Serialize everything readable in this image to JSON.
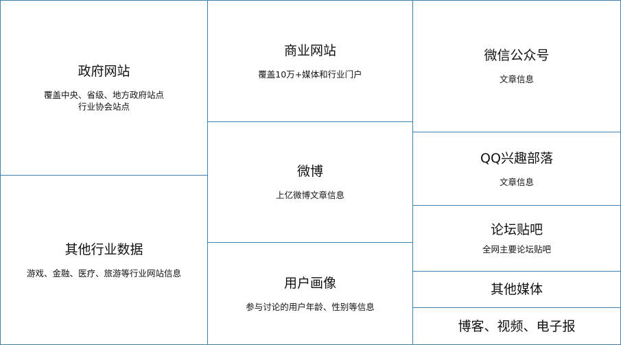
{
  "tiles": {
    "gov": {
      "title": "政府网站",
      "lines": [
        "覆盖中央、省级、地方政府站点",
        "行业协会站点"
      ]
    },
    "other_industry": {
      "title": "其他行业数据",
      "lines": [
        "游戏、金融、医疗、旅游等行业网站信息"
      ]
    },
    "business": {
      "title": "商业网站",
      "lines": [
        "覆盖10万+媒体和行业门户"
      ]
    },
    "weibo": {
      "title": "微博",
      "lines": [
        "上亿微博文章信息"
      ]
    },
    "user_profile": {
      "title": "用户画像",
      "lines": [
        "参与讨论的用户年龄、性别等信息"
      ]
    },
    "wechat": {
      "title": "微信公众号",
      "lines": [
        "文章信息"
      ]
    },
    "qq": {
      "title": "QQ兴趣部落",
      "lines": [
        "文章信息"
      ]
    },
    "forum": {
      "title": "论坛贴吧",
      "lines": [
        "全网主要论坛贴吧"
      ]
    },
    "other_media": {
      "title": "其他媒体"
    },
    "blog": {
      "title": "博客、视频、电子报"
    }
  },
  "colors": {
    "border": "#3f7fb0",
    "text": "#111111",
    "background": "#ffffff"
  }
}
